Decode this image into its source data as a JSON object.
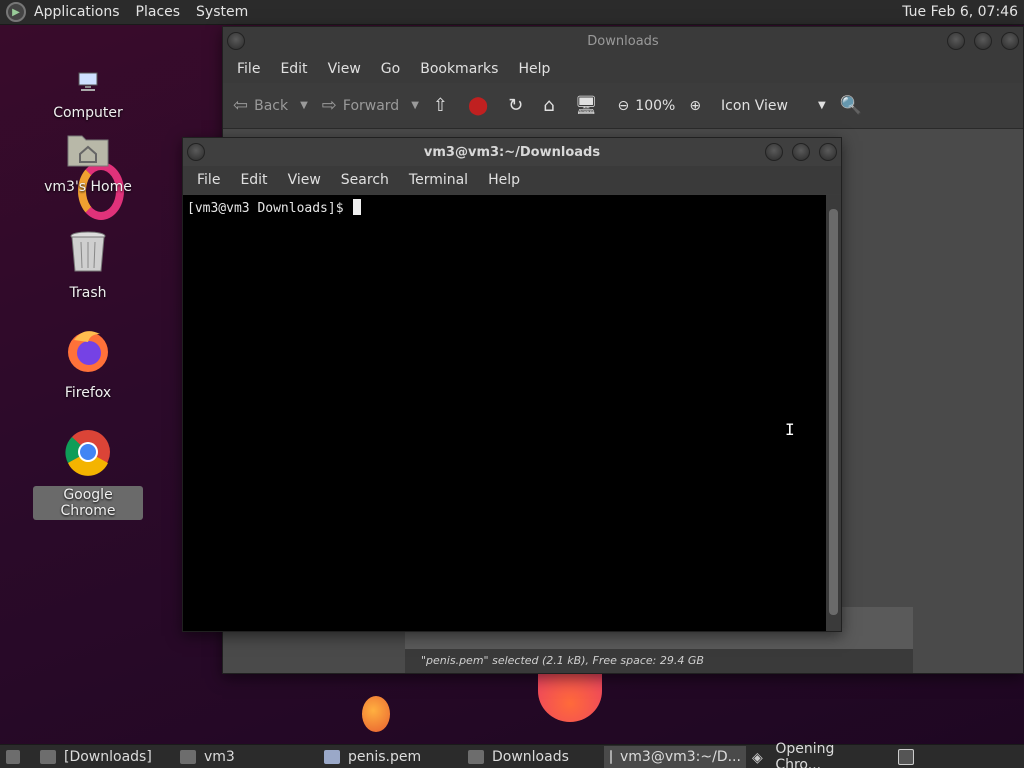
{
  "top_panel": {
    "menus": [
      "Applications",
      "Places",
      "System"
    ],
    "clock": "Tue Feb  6, 07:46"
  },
  "desktop": {
    "icons": [
      {
        "label": "Computer",
        "icon": "computer-icon"
      },
      {
        "label": "vm3's Home",
        "icon": "home-folder-icon"
      },
      {
        "label": "Trash",
        "icon": "trash-icon"
      },
      {
        "label": "Firefox",
        "icon": "firefox-icon"
      },
      {
        "label": "Google Chrome",
        "icon": "chrome-icon"
      }
    ]
  },
  "file_manager": {
    "title": "Downloads",
    "menus": [
      "File",
      "Edit",
      "View",
      "Go",
      "Bookmarks",
      "Help"
    ],
    "toolbar": {
      "back": "Back",
      "forward": "Forward",
      "zoom": "100%",
      "view_mode": "Icon View"
    },
    "status": "\"penis.pem\" selected (2.1 kB), Free space: 29.4 GB"
  },
  "terminal": {
    "title": "vm3@vm3:~/Downloads",
    "menus": [
      "File",
      "Edit",
      "View",
      "Search",
      "Terminal",
      "Help"
    ],
    "prompt": "[vm3@vm3 Downloads]$ "
  },
  "taskbar": {
    "items": [
      {
        "label": "[Downloads]",
        "icon": "folder-icon"
      },
      {
        "label": "vm3",
        "icon": "home-folder-icon"
      },
      {
        "label": "penis.pem",
        "icon": "document-icon"
      },
      {
        "label": "Downloads",
        "icon": "folder-icon"
      },
      {
        "label": "vm3@vm3:~/D...",
        "icon": "terminal-icon"
      },
      {
        "label": "Opening Chro...",
        "icon": "launch-icon"
      }
    ]
  },
  "colors": {
    "wallpaper": "#2c0a2a",
    "panel": "#2b2b2b",
    "window": "#3b3b3b",
    "terminal_bg": "#000000"
  }
}
